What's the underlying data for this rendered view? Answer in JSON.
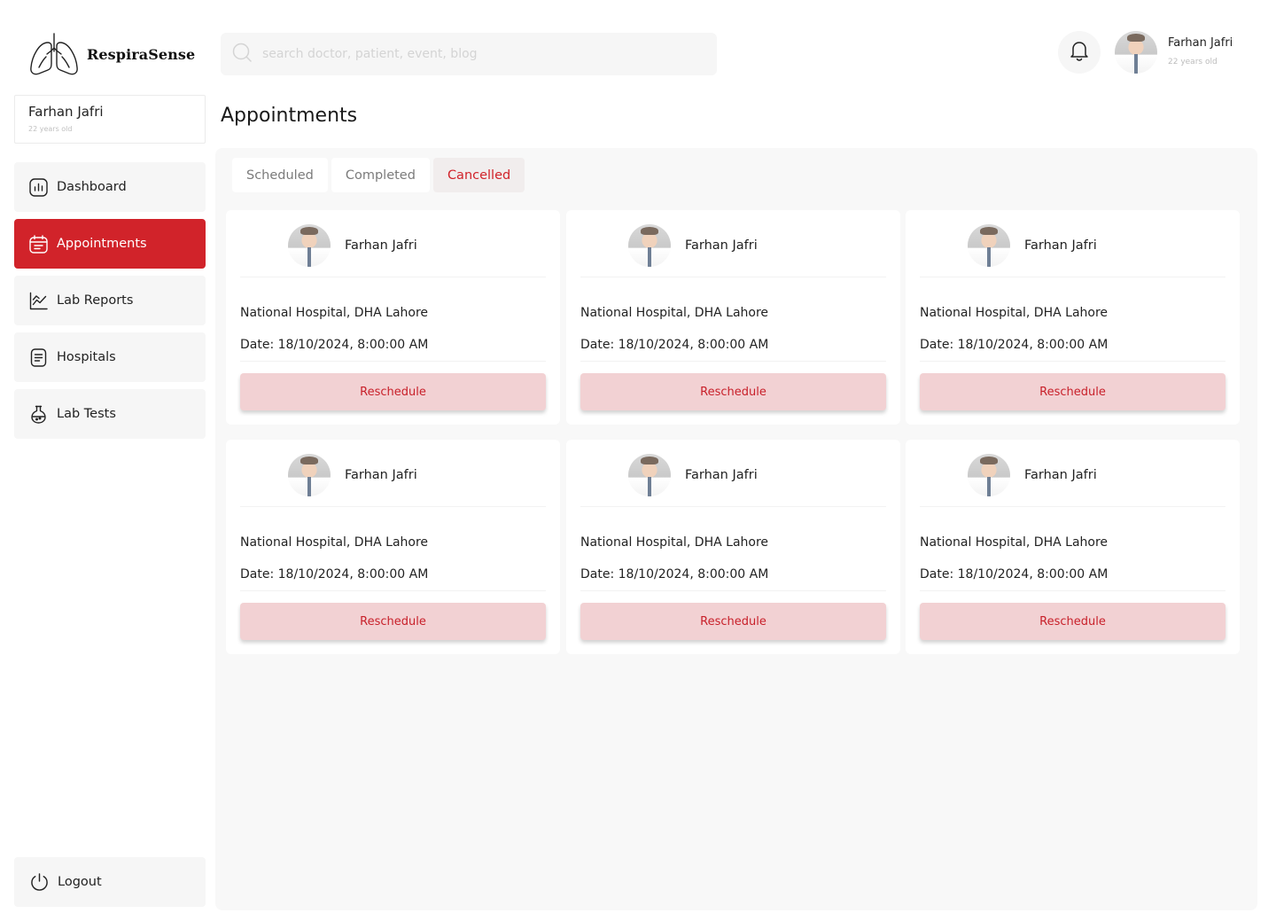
{
  "app": {
    "name": "RespiraSense"
  },
  "sidebar": {
    "profile": {
      "name": "Farhan Jafri",
      "age": "22 years old"
    },
    "items": [
      {
        "label": "Dashboard",
        "icon": "chart-icon"
      },
      {
        "label": "Appointments",
        "icon": "calendar-icon",
        "active": true
      },
      {
        "label": "Lab Reports",
        "icon": "line-chart-icon"
      },
      {
        "label": "Hospitals",
        "icon": "document-icon"
      },
      {
        "label": "Lab Tests",
        "icon": "flask-icon"
      }
    ],
    "logout": {
      "label": "Logout",
      "icon": "power-icon"
    }
  },
  "header": {
    "search": {
      "placeholder": "search doctor, patient, event, blog",
      "value": ""
    },
    "notification_icon": "bell-icon",
    "user": {
      "name": "Farhan Jafri",
      "age": "22 years old"
    }
  },
  "page": {
    "title": "Appointments"
  },
  "tabs": [
    {
      "label": "Scheduled",
      "active": false
    },
    {
      "label": "Completed",
      "active": false
    },
    {
      "label": "Cancelled",
      "active": true
    }
  ],
  "appointments": [
    {
      "doctor": "Farhan Jafri",
      "hospital": "National Hospital, DHA Lahore",
      "date": "Date: 18/10/2024, 8:00:00 AM",
      "action": "Reschedule"
    },
    {
      "doctor": "Farhan Jafri",
      "hospital": "National Hospital, DHA Lahore",
      "date": "Date: 18/10/2024, 8:00:00 AM",
      "action": "Reschedule"
    },
    {
      "doctor": "Farhan Jafri",
      "hospital": "National Hospital, DHA Lahore",
      "date": "Date: 18/10/2024, 8:00:00 AM",
      "action": "Reschedule"
    },
    {
      "doctor": "Farhan Jafri",
      "hospital": "National Hospital, DHA Lahore",
      "date": "Date: 18/10/2024, 8:00:00 AM",
      "action": "Reschedule"
    },
    {
      "doctor": "Farhan Jafri",
      "hospital": "National Hospital, DHA Lahore",
      "date": "Date: 18/10/2024, 8:00:00 AM",
      "action": "Reschedule"
    },
    {
      "doctor": "Farhan Jafri",
      "hospital": "National Hospital, DHA Lahore",
      "date": "Date: 18/10/2024, 8:00:00 AM",
      "action": "Reschedule"
    }
  ],
  "colors": {
    "accent": "#d1232a",
    "button_bg": "#f2d1d3",
    "panel_bg": "#f8f8f8"
  }
}
